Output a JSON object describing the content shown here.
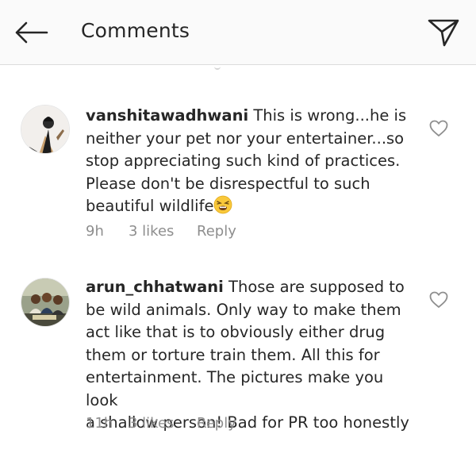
{
  "header": {
    "title": "Comments"
  },
  "comments": [
    {
      "username": "vanshitawadhwani",
      "text": " This is wrong...he is\nneither your pet nor your entertainer...so\nstop appreciating such kind of practices.\nPlease don't be disrespectful to such\nbeautiful wildlife",
      "emoji": "tired-face-emoji",
      "time": "9h",
      "likes": "3 likes",
      "reply": "Reply"
    },
    {
      "username": "arun_chhatwani",
      "text": " Those are supposed to\nbe wild animals. Only way to make them\nact like that is to obviously either drug\nthem or torture train them. All this for\nentertainment. The pictures make you look\na shallow person! Bad for PR too honestly",
      "time": "11h",
      "likes": "3 likes",
      "reply": "Reply"
    }
  ],
  "icons": {
    "back": "arrow-left-icon",
    "send": "paper-plane-icon",
    "like": "heart-outline-icon"
  },
  "colors": {
    "header_bg": "#fafafa",
    "text": "#262626",
    "meta": "#8e8e8e",
    "divider": "#dbdbdb"
  }
}
